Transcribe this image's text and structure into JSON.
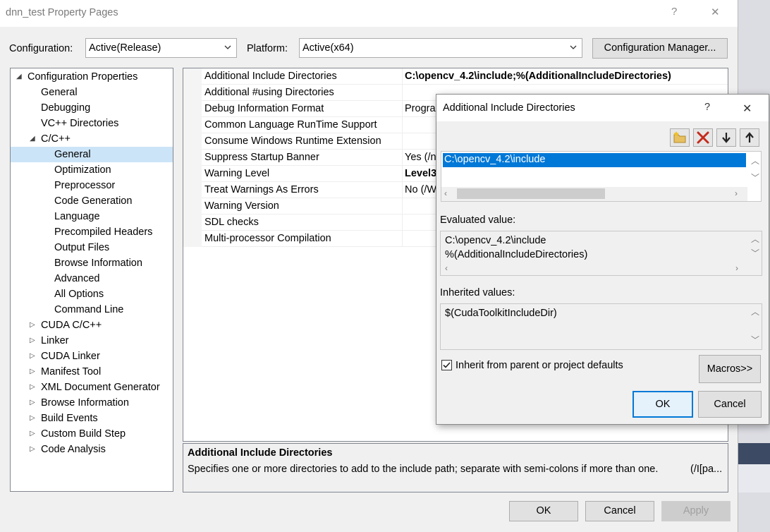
{
  "window": {
    "title": "dnn_test Property Pages",
    "help_glyph": "?",
    "close_glyph": "✕"
  },
  "config": {
    "configuration_label": "Configuration:",
    "configuration_value": "Active(Release)",
    "platform_label": "Platform:",
    "platform_value": "Active(x64)",
    "config_manager_label": "Configuration Manager..."
  },
  "tree": {
    "nodes": [
      {
        "label": "Configuration Properties",
        "arrow": "◢"
      },
      {
        "label": "General"
      },
      {
        "label": "Debugging"
      },
      {
        "label": "VC++ Directories"
      },
      {
        "label": "C/C++",
        "arrow": "◢"
      },
      {
        "label": "General"
      },
      {
        "label": "Optimization"
      },
      {
        "label": "Preprocessor"
      },
      {
        "label": "Code Generation"
      },
      {
        "label": "Language"
      },
      {
        "label": "Precompiled Headers"
      },
      {
        "label": "Output Files"
      },
      {
        "label": "Browse Information"
      },
      {
        "label": "Advanced"
      },
      {
        "label": "All Options"
      },
      {
        "label": "Command Line"
      },
      {
        "label": "CUDA C/C++",
        "arrow": "▷"
      },
      {
        "label": "Linker",
        "arrow": "▷"
      },
      {
        "label": "CUDA Linker",
        "arrow": "▷"
      },
      {
        "label": "Manifest Tool",
        "arrow": "▷"
      },
      {
        "label": "XML Document Generator",
        "arrow": "▷"
      },
      {
        "label": "Browse Information",
        "arrow": "▷"
      },
      {
        "label": "Build Events",
        "arrow": "▷"
      },
      {
        "label": "Custom Build Step",
        "arrow": "▷"
      },
      {
        "label": "Code Analysis",
        "arrow": "▷"
      }
    ]
  },
  "grid": {
    "rows": [
      {
        "name": "Additional Include Directories",
        "value": "C:\\opencv_4.2\\include;%(AdditionalIncludeDirectories)"
      },
      {
        "name": "Additional #using Directories",
        "value": ""
      },
      {
        "name": "Debug Information Format",
        "value": "Progra"
      },
      {
        "name": "Common Language RunTime Support",
        "value": ""
      },
      {
        "name": "Consume Windows Runtime Extension",
        "value": ""
      },
      {
        "name": "Suppress Startup Banner",
        "value": "Yes (/n"
      },
      {
        "name": "Warning Level",
        "value": "Level3"
      },
      {
        "name": "Treat Warnings As Errors",
        "value": "No (/W"
      },
      {
        "name": "Warning Version",
        "value": ""
      },
      {
        "name": "SDL checks",
        "value": ""
      },
      {
        "name": "Multi-processor Compilation",
        "value": ""
      }
    ]
  },
  "description": {
    "title": "Additional Include Directories",
    "text": "Specifies one or more directories to add to the include path; separate with semi-colons if more than one.",
    "switch": "(/I[pa..."
  },
  "footer": {
    "ok_label": "OK",
    "cancel_label": "Cancel",
    "apply_label": "Apply"
  },
  "dialog": {
    "title": "Additional Include Directories",
    "help_glyph": "?",
    "close_glyph": "✕",
    "list_items": [
      "C:\\opencv_4.2\\include"
    ],
    "evaluated_label": "Evaluated value:",
    "evaluated_lines": [
      "C:\\opencv_4.2\\include",
      "%(AdditionalIncludeDirectories)"
    ],
    "inherited_label": "Inherited values:",
    "inherited_lines": [
      "$(CudaToolkitIncludeDir)"
    ],
    "inherit_checkbox_label": "Inherit from parent or project defaults",
    "inherit_checked": true,
    "macros_label": "Macros>>",
    "ok_label": "OK",
    "cancel_label": "Cancel"
  },
  "colors": {
    "selection": "#0078d7",
    "tree_selection": "#cce4f7",
    "delete_red": "#c42b1c"
  },
  "icons": [
    "new-folder-icon",
    "delete-icon",
    "move-down-icon",
    "move-up-icon",
    "chevron-down-icon"
  ]
}
